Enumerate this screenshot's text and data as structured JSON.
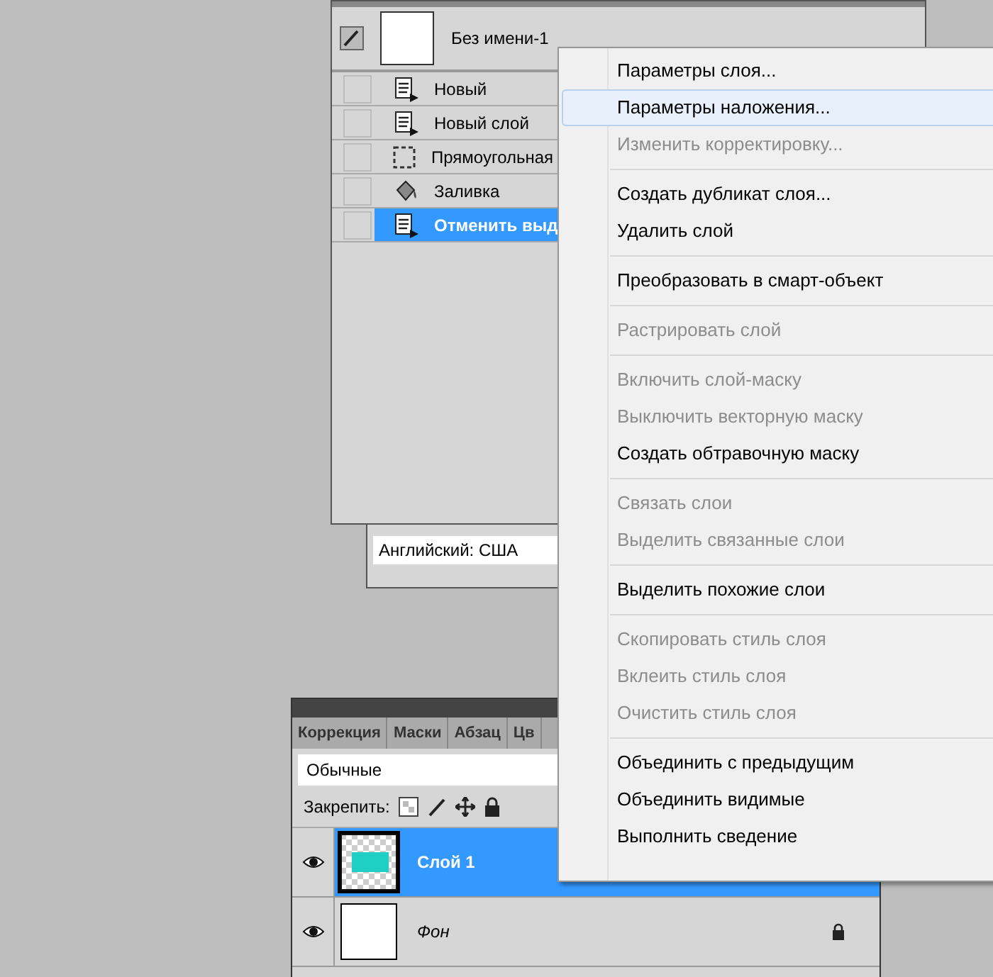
{
  "history_panel": {
    "snapshot": {
      "label": "Без имени-1"
    },
    "states": [
      {
        "kind": "document",
        "label": "Новый",
        "selected": false
      },
      {
        "kind": "document",
        "label": "Новый слой",
        "selected": false
      },
      {
        "kind": "marquee",
        "label": "Прямоугольная",
        "selected": false
      },
      {
        "kind": "bucket",
        "label": "Заливка",
        "selected": false
      },
      {
        "kind": "document",
        "label": "Отменить выд",
        "selected": true
      }
    ]
  },
  "language_box": {
    "value": "Английский: США"
  },
  "layers_panel": {
    "tabs": [
      {
        "label": "Коррекция",
        "selected": false
      },
      {
        "label": "Маски",
        "selected": false
      },
      {
        "label": "Абзац",
        "selected": false
      },
      {
        "label": "Цв",
        "selected": false
      }
    ],
    "blend_mode": "Обычные",
    "lock_label": "Закрепить:",
    "layers": [
      {
        "name": "Слой 1",
        "kind": "transparent",
        "selected": true,
        "visible": true
      },
      {
        "name": "Фон",
        "kind": "background",
        "selected": false,
        "visible": true,
        "locked": true
      }
    ]
  },
  "context_menu": {
    "groups": [
      [
        {
          "label": "Параметры слоя...",
          "disabled": false,
          "selected": false
        },
        {
          "label": "Параметры наложения...",
          "disabled": false,
          "selected": true
        },
        {
          "label": "Изменить корректировку...",
          "disabled": true,
          "selected": false
        }
      ],
      [
        {
          "label": "Создать дубликат слоя...",
          "disabled": false,
          "selected": false
        },
        {
          "label": "Удалить слой",
          "disabled": false,
          "selected": false
        }
      ],
      [
        {
          "label": "Преобразовать в смарт-объект",
          "disabled": false,
          "selected": false
        }
      ],
      [
        {
          "label": "Растрировать слой",
          "disabled": true,
          "selected": false
        }
      ],
      [
        {
          "label": "Включить слой-маску",
          "disabled": true,
          "selected": false
        },
        {
          "label": "Выключить векторную маску",
          "disabled": true,
          "selected": false
        },
        {
          "label": "Создать обтравочную маску",
          "disabled": false,
          "selected": false
        }
      ],
      [
        {
          "label": "Связать слои",
          "disabled": true,
          "selected": false
        },
        {
          "label": "Выделить связанные слои",
          "disabled": true,
          "selected": false
        }
      ],
      [
        {
          "label": "Выделить похожие слои",
          "disabled": false,
          "selected": false
        }
      ],
      [
        {
          "label": "Скопировать стиль слоя",
          "disabled": true,
          "selected": false
        },
        {
          "label": "Вклеить стиль слоя",
          "disabled": true,
          "selected": false
        },
        {
          "label": "Очистить стиль слоя",
          "disabled": true,
          "selected": false
        }
      ],
      [
        {
          "label": "Объединить с предыдущим",
          "disabled": false,
          "selected": false
        },
        {
          "label": "Объединить видимые",
          "disabled": false,
          "selected": false
        },
        {
          "label": "Выполнить сведение",
          "disabled": false,
          "selected": false
        }
      ]
    ]
  }
}
